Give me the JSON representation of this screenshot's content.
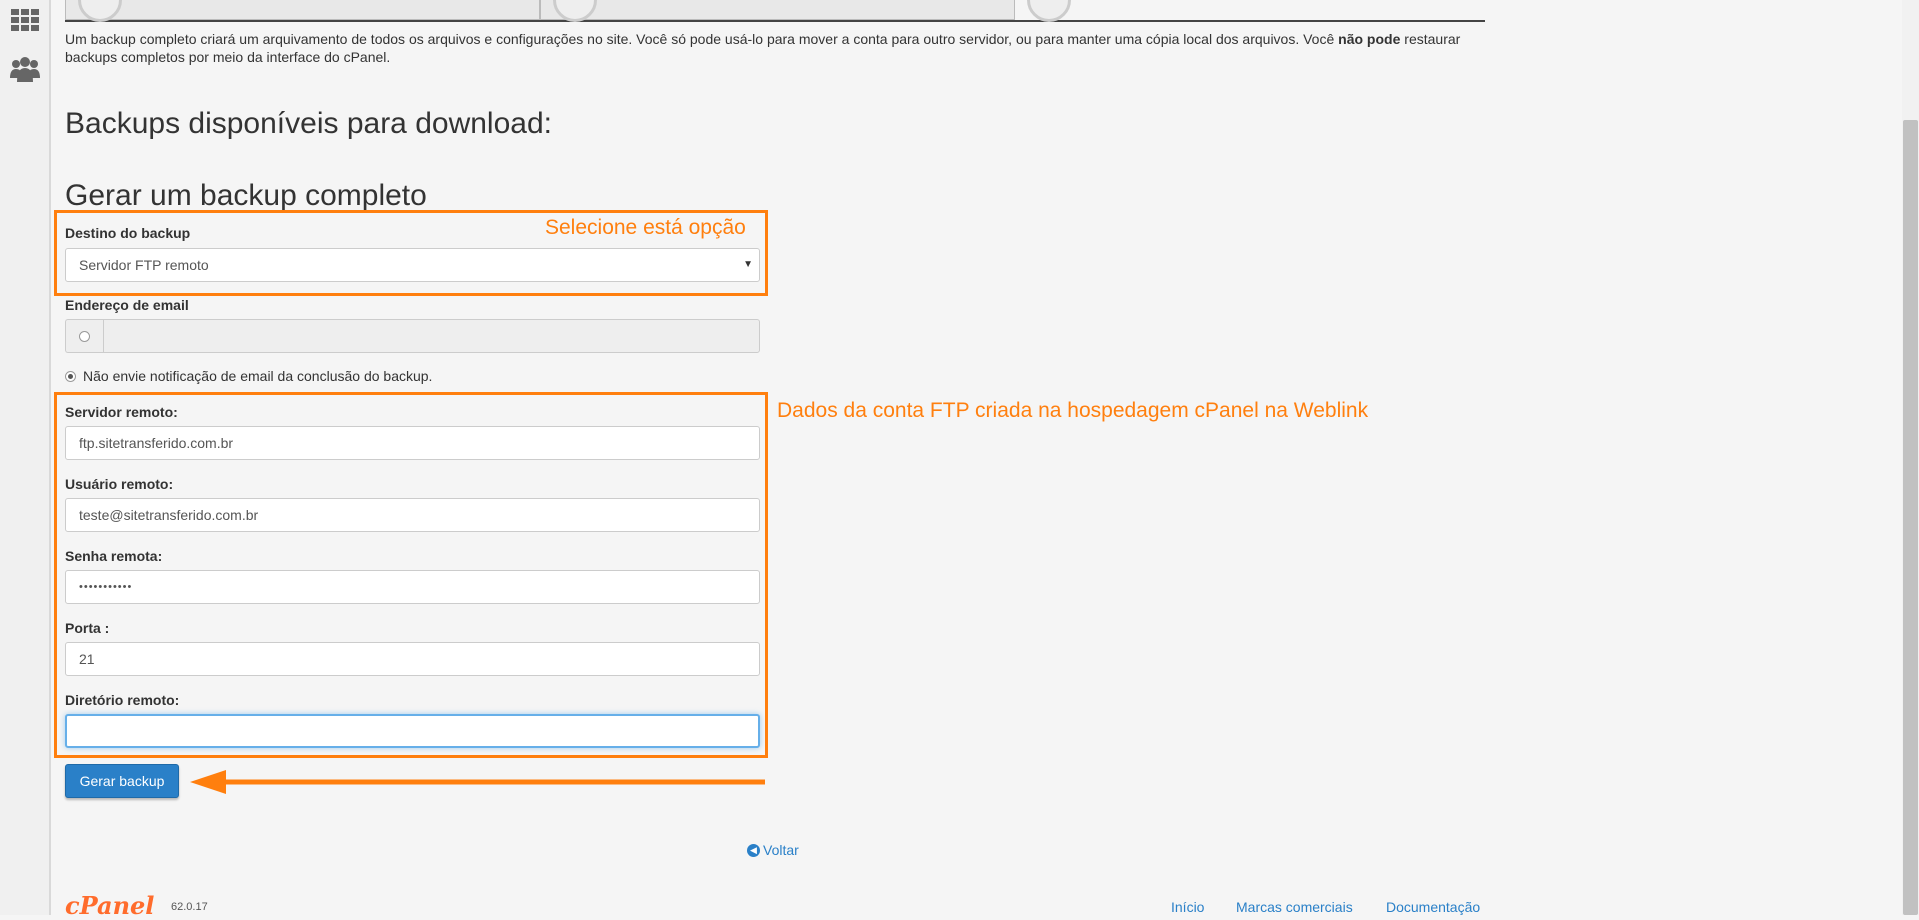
{
  "intro": {
    "part1": "Um backup completo criará um arquivamento de todos os arquivos e configurações no site. Você só pode usá-lo para mover a conta para outro servidor, ou para manter uma cópia local dos arquivos. Você ",
    "bold": "não pode",
    "part2": " restaurar backups completos por meio da interface do cPanel."
  },
  "headings": {
    "available": "Backups disponíveis para download:",
    "generate": "Gerar um backup completo"
  },
  "form": {
    "destination_label": "Destino do backup",
    "destination_value": "Servidor FTP remoto",
    "email_label": "Endereço de email",
    "email_value": "",
    "no_notify_label": "Não envie notificação de email da conclusão do backup.",
    "server_label": "Servidor remoto:",
    "server_value": "ftp.sitetransferido.com.br",
    "user_label": "Usuário remoto:",
    "user_value": "teste@sitetransferido.com.br",
    "password_label": "Senha remota:",
    "password_value": "•••••••••••",
    "port_label": "Porta :",
    "port_value": "21",
    "directory_label": "Diretório remoto:",
    "directory_value": "",
    "submit_label": "Gerar backup"
  },
  "back_label": "Voltar",
  "footer": {
    "logo": "cPanel",
    "version": "62.0.17",
    "links": [
      "Início",
      "Marcas comerciais",
      "Documentação"
    ]
  },
  "annotations": {
    "select_option": "Selecione está opção",
    "ftp_data": "Dados da conta FTP criada na hospedagem cPanel na Weblink"
  },
  "colors": {
    "annotation": "#ff7f0e",
    "primary": "#2a80c8",
    "cpanel_brand": "#ff6c2c"
  },
  "icons": [
    "grid-icon",
    "users-icon",
    "arrow-circle-left-icon"
  ]
}
